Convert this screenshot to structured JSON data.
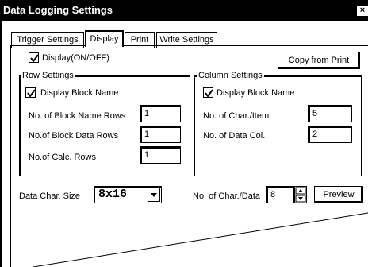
{
  "window": {
    "title": "Data Logging Settings",
    "close_glyph": "×"
  },
  "tabs": [
    {
      "label": "Trigger Settings",
      "active": false
    },
    {
      "label": "Display",
      "active": true
    },
    {
      "label": "Print",
      "active": false
    },
    {
      "label": "Write Settings",
      "active": false
    }
  ],
  "display_toggle": {
    "label": "Display(ON/OFF)",
    "checked": true
  },
  "copy_button": {
    "label": "Copy from Print"
  },
  "row_settings": {
    "legend": "Row Settings",
    "display_block_name": {
      "label": "Display Block Name",
      "checked": true
    },
    "block_name_rows": {
      "label": "No. of Block Name Rows",
      "value": "1"
    },
    "block_data_rows": {
      "label": "No.of Block Data Rows",
      "value": "1"
    },
    "calc_rows": {
      "label": "No.of Calc. Rows",
      "value": "1"
    }
  },
  "column_settings": {
    "legend": "Column Settings",
    "display_block_name": {
      "label": "Display Block Name",
      "checked": true
    },
    "char_per_item": {
      "label": "No. of Char./Item",
      "value": "5"
    },
    "data_cols": {
      "label": "No. of Data Col.",
      "value": "2"
    }
  },
  "data_char_size": {
    "label": "Data Char. Size",
    "value": "8x16"
  },
  "char_per_data": {
    "label": "No. of Char./Data",
    "value": "8"
  },
  "preview_button": {
    "label": "Preview"
  },
  "icons": {
    "close": "close-icon",
    "check": "checkmark-icon",
    "dropdown": "dropdown-arrow-icon",
    "spinner": "spinner-arrows-icon"
  }
}
